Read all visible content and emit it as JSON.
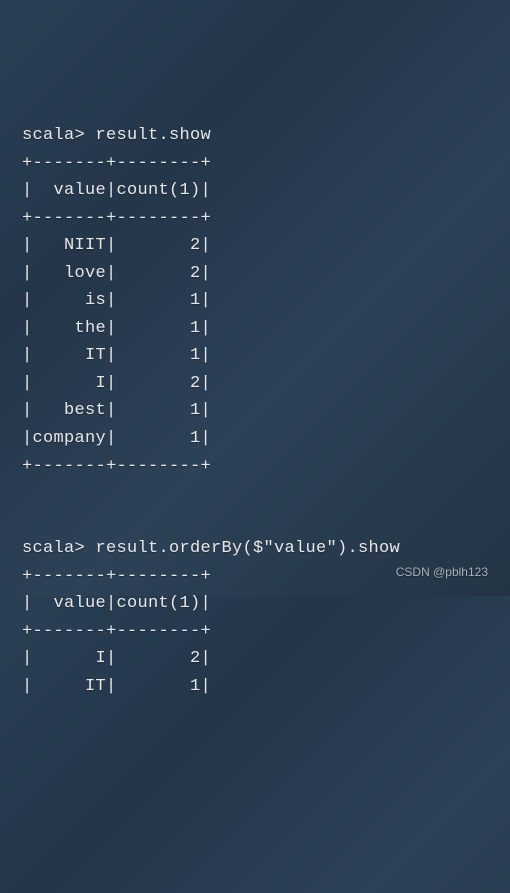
{
  "terminal": {
    "lines": [
      "scala> result.show",
      "+-------+--------+",
      "|  value|count(1)|",
      "+-------+--------+",
      "|   NIIT|       2|",
      "|   love|       2|",
      "|     is|       1|",
      "|    the|       1|",
      "|     IT|       1|",
      "|      I|       2|",
      "|   best|       1|",
      "|company|       1|",
      "+-------+--------+",
      "",
      "",
      "scala> result.orderBy($\"value\").show",
      "+-------+--------+",
      "|  value|count(1)|",
      "+-------+--------+",
      "|      I|       2|",
      "|     IT|       1|"
    ]
  },
  "watermark": "CSDN @pblh123"
}
